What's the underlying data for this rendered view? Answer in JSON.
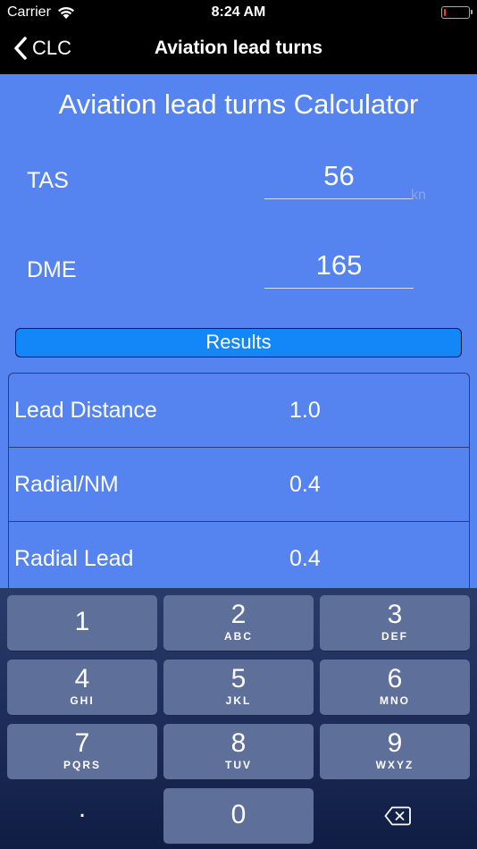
{
  "status_bar": {
    "carrier": "Carrier",
    "time": "8:24 AM",
    "battery_level": 0.1
  },
  "nav": {
    "back_label": "CLC",
    "title": "Aviation lead turns"
  },
  "calculator": {
    "title": "Aviation lead turns Calculator",
    "tas_label": "TAS",
    "tas_value": "56",
    "tas_unit": "kn",
    "dme_label": "DME",
    "dme_value": "165",
    "results_button": "Results"
  },
  "results": [
    {
      "label": "Lead Distance",
      "value": "1.0"
    },
    {
      "label": "Radial/NM",
      "value": "0.4"
    },
    {
      "label": "Radial Lead",
      "value": "0.4"
    }
  ],
  "keypad": {
    "keys": [
      {
        "num": "1",
        "letters": ""
      },
      {
        "num": "2",
        "letters": "ABC"
      },
      {
        "num": "3",
        "letters": "DEF"
      },
      {
        "num": "4",
        "letters": "GHI"
      },
      {
        "num": "5",
        "letters": "JKL"
      },
      {
        "num": "6",
        "letters": "MNO"
      },
      {
        "num": "7",
        "letters": "PQRS"
      },
      {
        "num": "8",
        "letters": "TUV"
      },
      {
        "num": "9",
        "letters": "WXYZ"
      }
    ],
    "decimal": ".",
    "zero": "0",
    "delete_icon": "backspace-icon"
  }
}
